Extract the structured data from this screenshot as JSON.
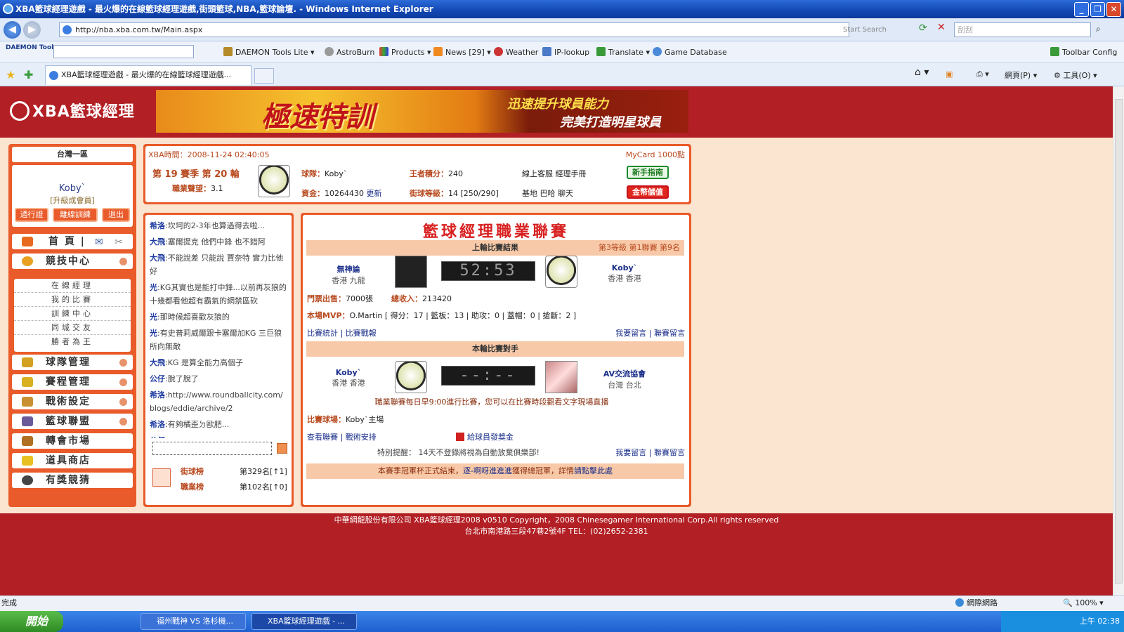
{
  "window": {
    "title": "XBA籃球經理遊戲 - 最火爆的在線籃球經理遊戲,街頭籃球,NBA,籃球論壇. - Windows Internet Explorer"
  },
  "address": {
    "url": "http://nba.xba.com.tw/Main.aspx",
    "start_search": "Start Search",
    "search_value": "刮刮"
  },
  "toolbar": {
    "daemon": "DAEMON Tools",
    "items": [
      "DAEMON Tools Lite",
      "AstroBurn",
      "Products",
      "News [29]",
      "Weather",
      "IP-lookup",
      "Translate",
      "Game Database"
    ],
    "config": "Toolbar Config"
  },
  "tab": {
    "title": "XBA籃球經理遊戲 - 最火爆的在線籃球經理遊戲..."
  },
  "commandbar": {
    "page": "網頁(P)",
    "tools": "工具(O)"
  },
  "site": {
    "brand": "XBA籃球經理",
    "banner": {
      "main": "極速特訓",
      "line1": "迅速提升球員能力",
      "line2": "完美打造明星球員"
    }
  },
  "sidebar": {
    "region": "台灣一區",
    "user": "Koby`",
    "rank": "[升級成會員]",
    "buttons": [
      "通行證",
      "離線訓練",
      "退出"
    ],
    "home": "首 頁 |",
    "menus": [
      "競技中心",
      "球隊管理",
      "賽程管理",
      "戰術設定",
      "籃球聯盟",
      "轉會市場",
      "道具商店",
      "有獎競猜"
    ],
    "submenu": [
      "在線經理",
      "我的比賽",
      "訓練中心",
      "同城交友",
      "勝者為王"
    ]
  },
  "status": {
    "time_label": "XBA時間：",
    "time": "2008-11-24 02:40:05",
    "mycard": "MyCard 1000點",
    "season": "第 19 賽季  第 20 輪",
    "career_label": "職業聲望：",
    "career": "3.1",
    "team_label": "球隊：",
    "team": "Koby`",
    "king_label": "王者積分：",
    "king": "240",
    "service": "線上客服  經理手冊",
    "funds_label": "資金：",
    "funds": "10264430",
    "update": "更新",
    "street_label": "街球等級：",
    "street": "14 [250/290]",
    "base": "基地  巴哈  聊天",
    "guide_btn": "新手指南",
    "deposit_btn": "金幣儲值"
  },
  "chat": {
    "messages": [
      {
        "n": "希洛",
        "t": ":坎坷的2-3年也算過得去啦..."
      },
      {
        "n": "大飛",
        "t": ":塞爾提克  他們中鋒  也不錯阿"
      },
      {
        "n": "大飛",
        "t": ":不能說差  只能說  賈奈特  實力比他好"
      },
      {
        "n": "光",
        "t": ":KG其實也是能打中鋒...以前再灰狼的十幾都看他超有霸氣的網禁區砍"
      },
      {
        "n": "光",
        "t": ":那時候超喜歡灰狼的"
      },
      {
        "n": "光",
        "t": ":有史普莉威爾跟卡塞爾加KG 三巨狼所向無敵"
      },
      {
        "n": "大飛",
        "t": ":KG 是算全能力高個子"
      },
      {
        "n": "公仔",
        "t": ":脫了脫了"
      },
      {
        "n": "希洛",
        "t": ":http://www.roundballcity.com/blogs/eddie/archive/2"
      },
      {
        "n": "希洛",
        "t": ":有夠橘歪ㄉ歐肥..."
      },
      {
        "n": "公仔",
        "t": "..."
      },
      {
        "n": "公仔",
        "t": "......."
      }
    ],
    "rank_street_label": "街球榜",
    "rank_street": "第329名[↑1]",
    "rank_career_label": "職業榜",
    "rank_career": "第102名[↑0]"
  },
  "league": {
    "title": "籃球經理職業聯賽",
    "last_header": "上輪比賽結果",
    "last_info": "第3等級  第1聯賽  第9名",
    "home_team": "無神論",
    "home_loc": "香港  九龍",
    "score": "52:53",
    "away_team": "Koby`",
    "away_loc": "香港  香港",
    "ticket_label": "門票出售：",
    "ticket": "7000張",
    "income_label": "總收入：",
    "income": "213420",
    "mvp_label": "本場MVP：",
    "mvp": "O.Martin [ 得分：17 | 籃板：13 | 助攻：0 | 蓋帽：0 | 搶斷：2 ]",
    "stats_link": "比賽統計",
    "report_link": "比賽戰報",
    "msg_link": "我要留言",
    "league_msg_link": "聯賽留言",
    "next_header": "本輪比賽對手",
    "next_home": "Koby`",
    "next_home_loc": "香港  香港",
    "next_score": "--:--",
    "next_away": "AV交流協會",
    "next_away_loc": "台灣  台北",
    "notice": "職業聯賽每日早9:00進行比賽，您可以在比賽時段觀看文字現場直播",
    "venue_label": "比賽球場：",
    "venue": "Koby`主場",
    "view_league": "查看聯賽",
    "tactics": "戰術安排",
    "bonus": "給球員發獎金",
    "reminder": "特別提醒：  14天不登錄將視為自動放棄俱樂部!",
    "msg_link2": "我要留言",
    "league_msg_link2": "聯賽留言",
    "champion_pre": "本賽季冠軍杯正式結束，",
    "champion_link": "逐-啊呀進進進",
    "champion_mid": "獲得總冠軍，詳情",
    "champion_more": "請點擊此處"
  },
  "footer": {
    "line1": "中華網龍股份有限公司  XBA籃球經理2008 v0510     Copyright，2008 Chinesegamer International Corp.All rights reserved",
    "line2": "台北市南港路三段47巷2號4F TEL：(02)2652-2381"
  },
  "statusbar": {
    "done": "完成",
    "zone": "網際網路",
    "zoom": "100%"
  },
  "taskbar": {
    "start": "開始",
    "tasks": [
      "福州戰神 VS 洛杉機...",
      "XBA籃球經理遊戲 - ..."
    ],
    "clock": "上午 02:38"
  }
}
